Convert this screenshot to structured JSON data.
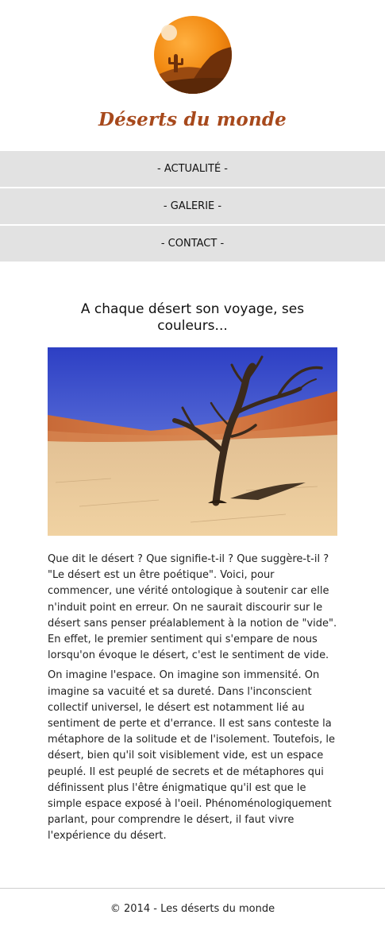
{
  "site": {
    "title": "Déserts du monde"
  },
  "nav": {
    "items": [
      {
        "label": "- ACTUALITÉ -"
      },
      {
        "label": "- GALERIE -"
      },
      {
        "label": "- CONTACT -"
      }
    ]
  },
  "main": {
    "heading": "A chaque désert son voyage, ses couleurs...",
    "image_alt": "Arbre mort dans le désert",
    "paragraphs": [
      "Que dit le désert ? Que signifie-t-il ? Que suggère-t-il ? \"Le désert est un être poétique\". Voici, pour commencer, une vérité ontologique à soutenir car elle n'induit point en erreur. On ne saurait discourir sur le désert sans penser préalablement à la notion de \"vide\". En effet, le premier sentiment qui s'empare de nous lorsqu'on évoque le désert, c'est le sentiment de vide.",
      "On imagine l'espace. On imagine son immensité. On imagine sa vacuité et sa dureté. Dans l'inconscient collectif universel, le désert est notamment lié au sentiment de perte et d'errance. Il est sans conteste la métaphore de la solitude et de l'isolement. Toutefois, le désert, bien qu'il soit visiblement vide, est un espace peuplé. Il est peuplé de secrets et de métaphores qui définissent plus l'être énigmatique qu'il est que le simple espace exposé à l'oeil. Phénoménologiquement parlant, pour comprendre le désert, il faut vivre l'expérience du désert."
    ]
  },
  "footer": {
    "text": "© 2014 - Les déserts du monde"
  },
  "colors": {
    "title": "#a7491c",
    "nav_background": "#e2e2e2",
    "logo_orange": "#f28a12",
    "logo_dune": "#7a3a0e"
  },
  "icons": {
    "logo": "desert-sun-cactus-logo"
  }
}
